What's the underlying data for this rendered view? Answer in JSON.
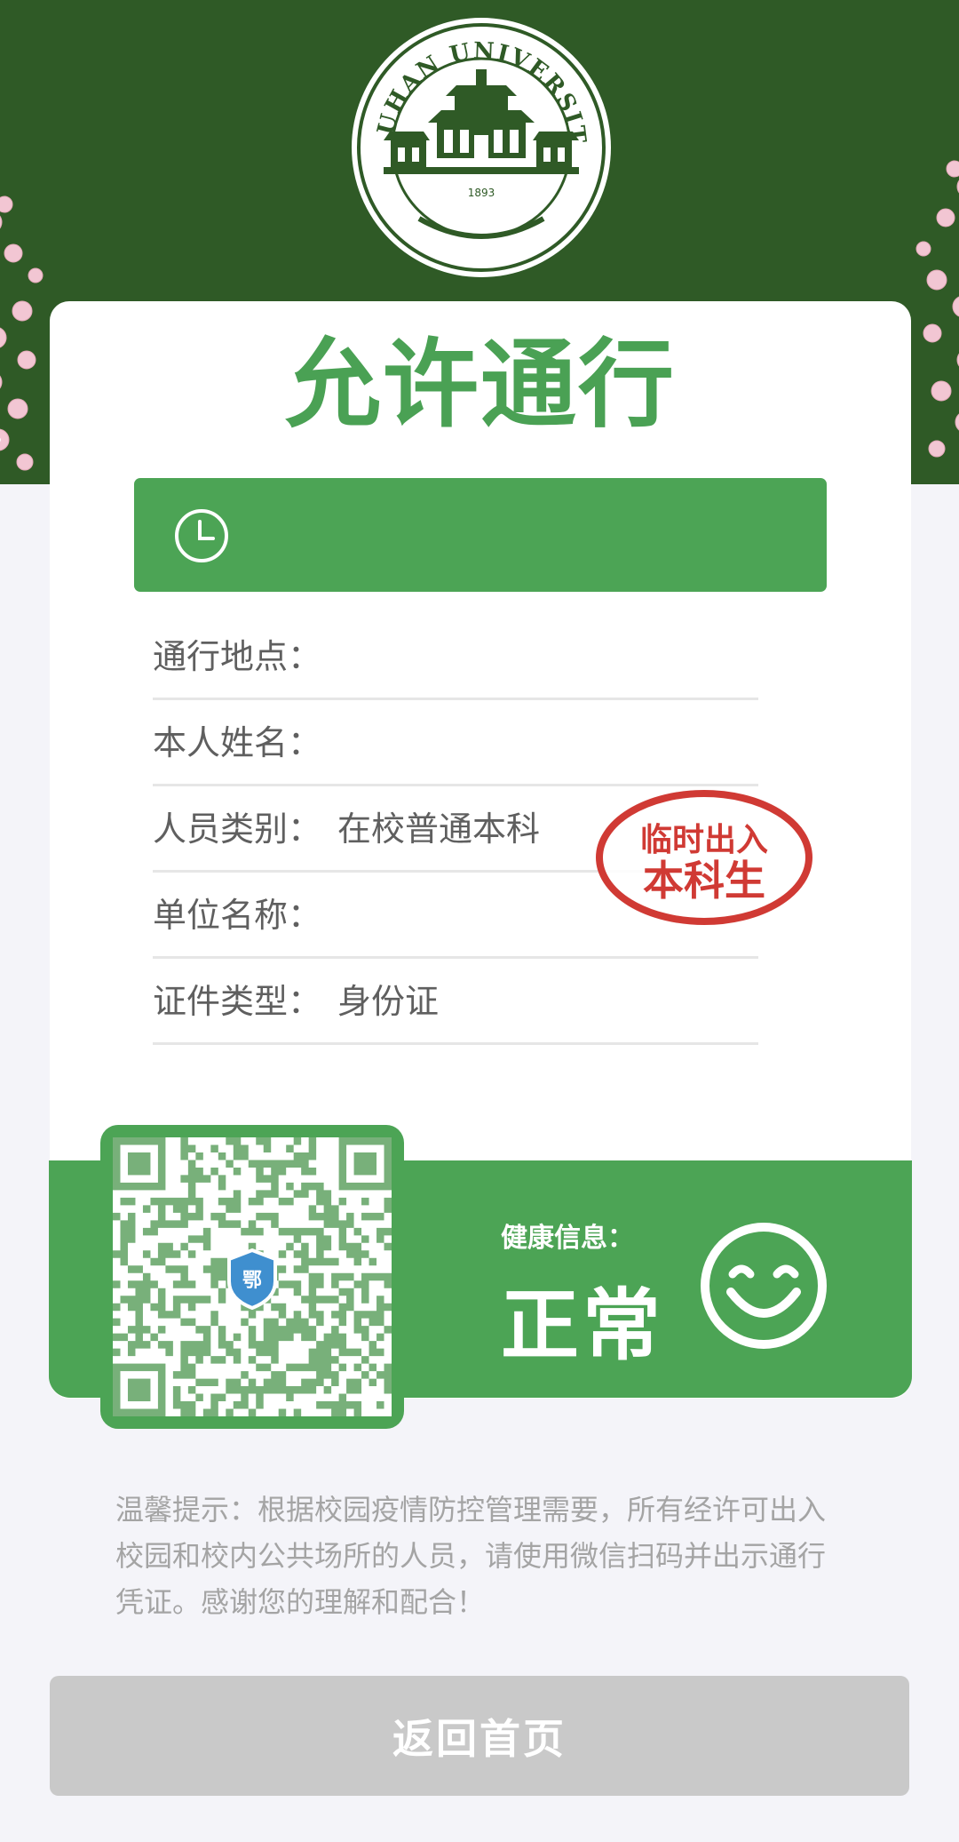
{
  "header": {
    "logo_ring_text": "WUHAN UNIVERSITY",
    "logo_year": "1893",
    "colors": {
      "banner": "#2f5a26",
      "accent": "#4ca455",
      "blossom": "#f2c6d3"
    }
  },
  "card": {
    "status_title": "允许通行",
    "time_bar_icon": "clock-icon",
    "time_text": ""
  },
  "info": {
    "rows": [
      {
        "label": "通行地点：",
        "value": ""
      },
      {
        "label": "本人姓名：",
        "value": ""
      },
      {
        "label": "人员类别：",
        "value": "在校普通本科"
      },
      {
        "label": "单位名称：",
        "value": ""
      },
      {
        "label": "证件类型：",
        "value": "身份证"
      }
    ]
  },
  "stamp": {
    "line1": "临时出入",
    "line2": "本科生",
    "color": "#d03a34"
  },
  "qr": {
    "badge_text": "鄂"
  },
  "health": {
    "label": "健康信息：",
    "status": "正常",
    "icon": "smiley-icon"
  },
  "tip": {
    "text": "温馨提示：根据校园疫情防控管理需要，所有经许可出入校园和校内公共场所的人员，请使用微信扫码并出示通行凭证。感谢您的理解和配合！"
  },
  "footer": {
    "return_label": "返回首页"
  }
}
